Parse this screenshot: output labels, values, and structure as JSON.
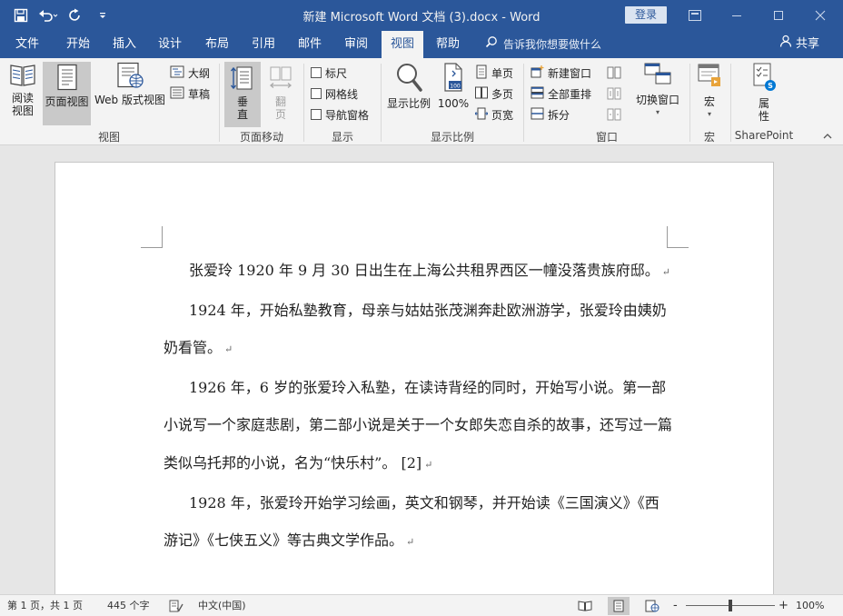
{
  "titlebar": {
    "title": "新建 Microsoft Word 文档 (3).docx  -  Word",
    "login_label": "登录",
    "quick_access": [
      "save-icon",
      "undo-icon",
      "redo-icon",
      "customize-qat-icon"
    ]
  },
  "tabs": [
    {
      "label": "文件",
      "active": false
    },
    {
      "label": "开始",
      "active": false
    },
    {
      "label": "插入",
      "active": false
    },
    {
      "label": "设计",
      "active": false
    },
    {
      "label": "布局",
      "active": false
    },
    {
      "label": "引用",
      "active": false
    },
    {
      "label": "邮件",
      "active": false
    },
    {
      "label": "审阅",
      "active": false
    },
    {
      "label": "视图",
      "active": true
    },
    {
      "label": "帮助",
      "active": false
    }
  ],
  "tell_me": "告诉我你想要做什么",
  "share": "共享",
  "ribbon": {
    "views": {
      "group_label": "视图",
      "read_mode": "阅读\n视图",
      "print_layout": "页面视图",
      "web_layout": "Web 版式视图",
      "outline": "大纲",
      "draft": "草稿"
    },
    "page_movement": {
      "group_label": "页面移动",
      "vertical": "垂\n直",
      "side_to_side": "翻\n页"
    },
    "show": {
      "group_label": "显示",
      "ruler": "标尺",
      "gridlines": "网格线",
      "nav_pane": "导航窗格"
    },
    "zoom": {
      "group_label": "显示比例",
      "zoom": "显示比例",
      "hundred": "100%",
      "one_page": "单页",
      "multi_page": "多页",
      "page_width": "页宽"
    },
    "window": {
      "group_label": "窗口",
      "new_window": "新建窗口",
      "arrange_all": "全部重排",
      "split": "拆分",
      "switch_windows": "切换窗口"
    },
    "macros": {
      "group_label": "宏",
      "macros": "宏"
    },
    "sharepoint": {
      "group_label": "SharePoint",
      "properties": "属\n性"
    }
  },
  "document": {
    "paragraphs": [
      "张爱玲 1920 年 9 月 30 日出生在上海公共租界西区一幢没落贵族府邸。",
      "1924 年，开始私塾教育，母亲与姑姑张茂渊奔赴欧洲游学，张爱玲由姨奶奶看管。",
      "1926 年，6 岁的张爱玲入私塾，在读诗背经的同时，开始写小说。第一部小说写一个家庭悲剧，第二部小说是关于一个女郎失恋自杀的故事，还写过一篇类似乌托邦的小说，名为“快乐村”。 [2]",
      "1928 年，张爱玲开始学习绘画，英文和钢琴，并开始读《三国演义》《西游记》《七侠五义》等古典文学作品。"
    ],
    "paragraph_mark": "↵"
  },
  "statusbar": {
    "page_info": "第 1 页，共 1 页",
    "word_count": "445 个字",
    "language": "中文(中国)",
    "zoom_level": "100%",
    "zoom_minus": "-",
    "zoom_plus": "+"
  },
  "colors": {
    "title_bar": "#2b579a",
    "ribbon_bg": "#f3f3f3",
    "canvas_bg": "#e6e6e6"
  }
}
